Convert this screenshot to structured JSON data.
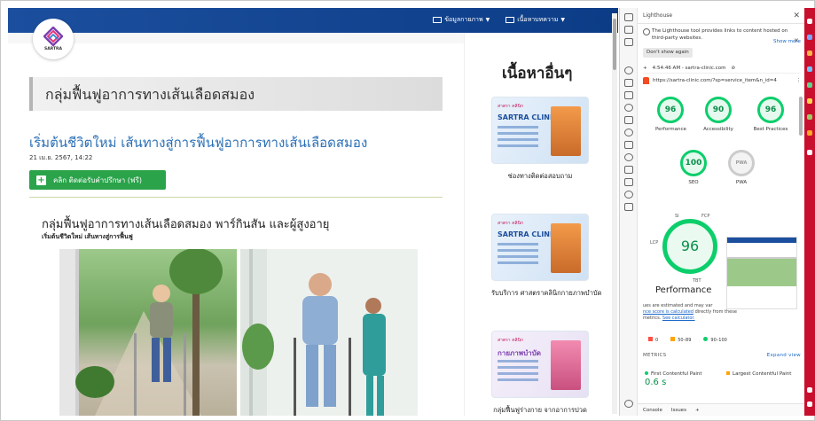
{
  "website": {
    "nav": {
      "item1": "ข้อมูลกายภาพ",
      "item2": "เนื้อหาบทความ"
    },
    "logo_text": "SARTRA",
    "page_title": "กลุ่มฟื้นฟูอาการทางเส้นเลือดสมอง",
    "post_title": "เริ่มต้นชีวิตใหม่ เส้นทางสู่การฟื้นฟูอาการทางเส้นเลือดสมอง",
    "post_date": "21 เม.ย. 2567, 14:22",
    "cta_label": "คลิก ติดต่อรับคำปรึกษา (ฟรี)",
    "sub_title": "กลุ่มฟื้นฟูอาการทางเส้นเลือดสมอง พาร์กินสัน และผู้สูงอายุ",
    "sub_sub": "เริ่มต้นชีวิตใหม่ เส้นทางสู่การฟื้นฟู",
    "side_title": "เนื้อหาอื่นๆ",
    "cards": [
      {
        "brand": "สาตรา คลินิก",
        "clinic": "SARTRA CLINIC",
        "caption": "ช่องทางติดต่อสอบถาม"
      },
      {
        "brand": "สาตรา คลินิก",
        "clinic": "SARTRA CLINIC",
        "caption": "รับบริการ ศาสตราคลินิกกายภาพบำบัด"
      },
      {
        "brand": "สาตรา คลินิก",
        "clinic": "กายภาพบำบัด",
        "caption": "กลุ่มฟื้นฟูร่างกาย จากอาการปวด"
      }
    ]
  },
  "devtools": {
    "panel_title": "Lighthouse",
    "notice": "The Lighthouse tool provides links to content hosted on third-party websites.",
    "show_more": "Show more",
    "dont_show": "Don't show again",
    "report_time": "4:54:46 AM - sartra-clinic.com",
    "url": "https://sartra-clinic.com/?sp=service_item&n_id=4",
    "scores": [
      {
        "value": "96",
        "label": "Performance"
      },
      {
        "value": "90",
        "label": "Accessibility"
      },
      {
        "value": "96",
        "label": "Best Practices"
      },
      {
        "value": "100",
        "label": "SEO"
      },
      {
        "value": "PWA",
        "label": "PWA"
      }
    ],
    "big_score": "96",
    "big_label": "Performance",
    "arc_labels": {
      "si": "SI",
      "fcp": "FCP",
      "lcp": "LCP",
      "tbt": "TBT"
    },
    "perf_note_pre": "ues are estimated and may var",
    "perf_note_link": "nce score is calculated",
    "perf_note_post": "directly from these metrics.",
    "see_calc": "See calculator.",
    "legend": {
      "l1": "0",
      "l2": "50–89",
      "l3": "90–100"
    },
    "metrics_label": "METRICS",
    "expand_view": "Expand view",
    "metric1_name": "First Contentful Paint",
    "metric1_value": "0.6 s",
    "metric2_name": "Largest Contentful Paint",
    "drawer": {
      "console": "Console",
      "issues": "Issues"
    }
  },
  "colors": {
    "good": "#0cce6b",
    "average": "#ffa400",
    "poor": "#ff4e42",
    "brand_blue": "#1b4f9e",
    "cta_green": "#2aa34a",
    "edge_red": "#c8102e"
  }
}
